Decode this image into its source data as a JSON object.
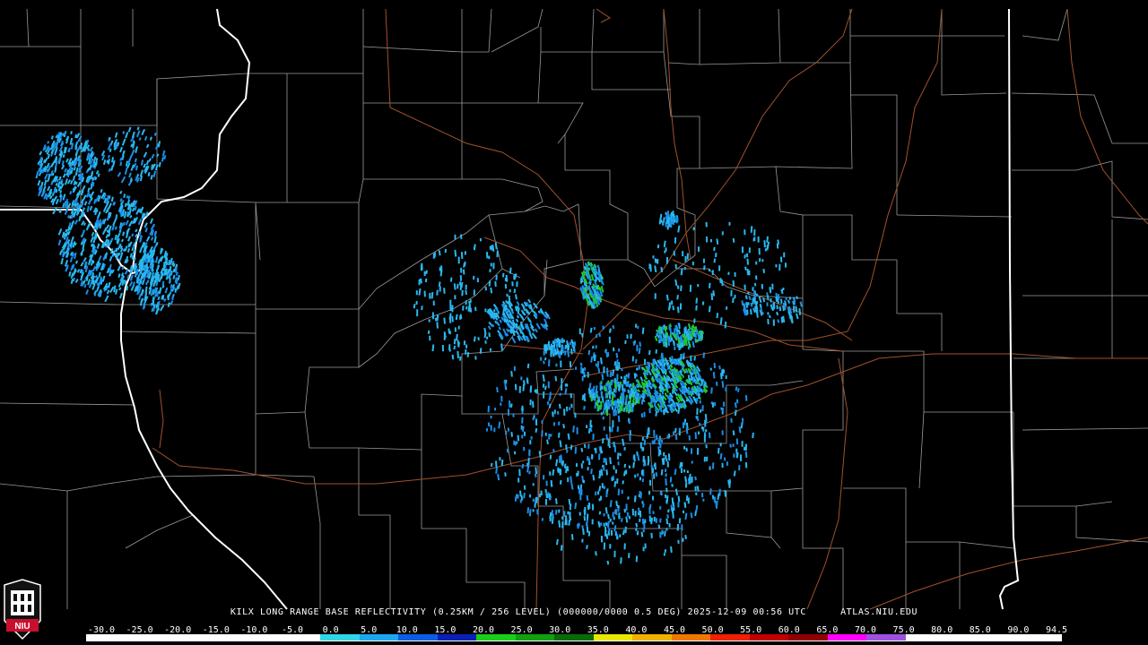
{
  "caption": {
    "product": "KILX LONG RANGE BASE REFLECTIVITY (0.25KM / 256 LEVEL) (000000/0000 0.5 DEG) 2025-12-09 00:56 UTC",
    "site": "ATLAS.NIU.EDU"
  },
  "logo": {
    "text": "NIU"
  },
  "colorbar": {
    "labels": [
      "-30.0",
      "-25.0",
      "-20.0",
      "-15.0",
      "-10.0",
      "-5.0",
      "0.0",
      "5.0",
      "10.0",
      "15.0",
      "20.0",
      "25.0",
      "30.0",
      "35.0",
      "40.0",
      "45.0",
      "50.0",
      "55.0",
      "60.0",
      "65.0",
      "70.0",
      "75.0",
      "80.0",
      "85.0",
      "90.0",
      "94.5"
    ],
    "colors": [
      "#ffffff",
      "#ffffff",
      "#ffffff",
      "#ffffff",
      "#ffffff",
      "#ffffff",
      "#2fd6e6",
      "#1ba8ee",
      "#0b5ce6",
      "#0a1eb8",
      "#18d018",
      "#10a010",
      "#0a6a0a",
      "#e8e800",
      "#f0b000",
      "#f07800",
      "#f02000",
      "#c00000",
      "#900000",
      "#ff00ff",
      "#a050e0",
      "#ffffff",
      "#ffffff",
      "#ffffff",
      "#ffffff"
    ]
  },
  "map_colors": {
    "background": "#000000",
    "county_lines": "#9a9a9a",
    "state_lines": "#ffffff",
    "highways": "#a0522d",
    "echo_light": "#29b8f0",
    "echo_mid": "#1a8ee8",
    "echo_strong": "#20c830"
  }
}
